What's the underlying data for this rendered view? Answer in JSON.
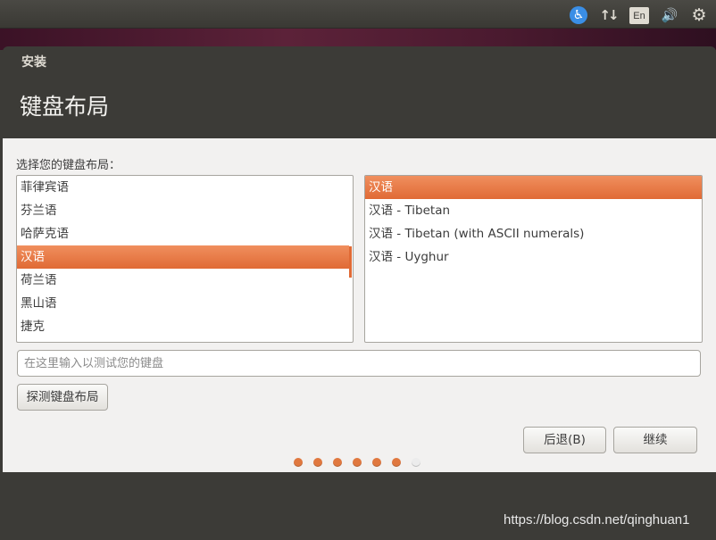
{
  "top_panel": {
    "language_indicator": "En",
    "icons": [
      "accessibility-icon",
      "network-icon",
      "volume-icon",
      "gear-icon"
    ]
  },
  "window": {
    "title": "安装",
    "heading": "键盘布局"
  },
  "layout_prompt": "选择您的键盘布局：",
  "languages": [
    {
      "label": "菲律宾语"
    },
    {
      "label": "芬兰语"
    },
    {
      "label": "哈萨克语"
    },
    {
      "label": "汉语",
      "selected": true
    },
    {
      "label": "荷兰语"
    },
    {
      "label": "黑山语"
    },
    {
      "label": "捷克"
    }
  ],
  "variants": [
    {
      "label": "汉语",
      "selected": true
    },
    {
      "label": "汉语 - Tibetan"
    },
    {
      "label": "汉语 - Tibetan (with ASCII numerals)"
    },
    {
      "label": "汉语 - Uyghur"
    }
  ],
  "test_input": {
    "placeholder": "在这里输入以测试您的键盘",
    "value": ""
  },
  "buttons": {
    "detect": "探测键盘布局",
    "back": "后退(B)",
    "continue": "继续"
  },
  "progress": {
    "total_steps": 7,
    "current_step": 7
  },
  "watermark": "https://blog.csdn.net/qinghuan1",
  "colors": {
    "accent": "#e06a35",
    "panel": "#3c3b37",
    "content_bg": "#f2f1f0"
  }
}
